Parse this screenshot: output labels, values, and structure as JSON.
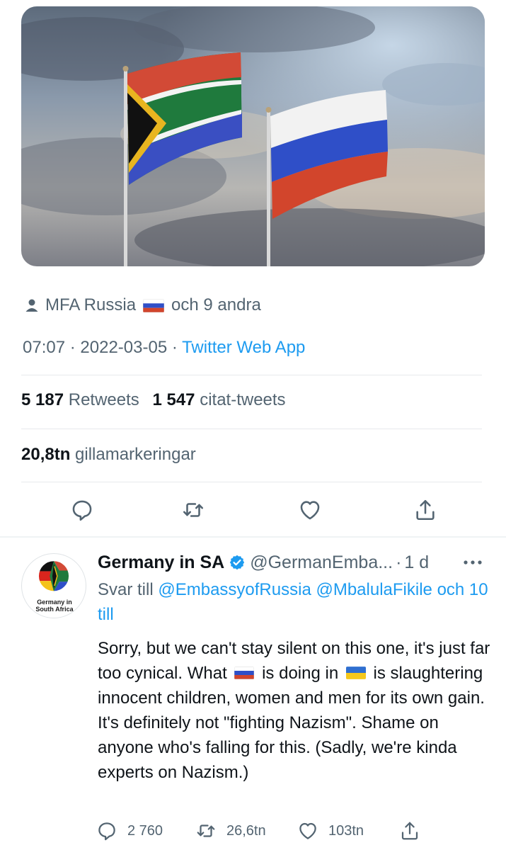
{
  "tweet": {
    "media": {
      "description_icon": "flags-photo",
      "subject": "South Africa and Russia flags against cloudy sky"
    },
    "liked_by": {
      "name": "MFA Russia",
      "suffix": "och 9 andra",
      "flag": "russia"
    },
    "timestamp": {
      "time": "07:07",
      "separator": "·",
      "date": "2022-03-05",
      "source": "Twitter Web App"
    },
    "stats": {
      "retweets_count": "5 187",
      "retweets_label": "Retweets",
      "quotes_count": "1 547",
      "quotes_label": "citat-tweets",
      "likes_count": "20,8tn",
      "likes_label": "gillamarkeringar"
    },
    "actions": [
      "reply-icon",
      "retweet-icon",
      "like-icon",
      "share-icon"
    ]
  },
  "reply": {
    "avatar_text_line1": "Germany in",
    "avatar_text_line2": "South Africa",
    "author_name": "Germany in SA",
    "handle": "@GermanEmba...",
    "separator": "·",
    "time": "1 d",
    "reply_to_prefix": "Svar till",
    "mention1": "@EmbassyofRussia",
    "mention2": "@MbalulaFikile",
    "reply_to_suffix": "och 10 till",
    "body": {
      "part1": "Sorry, but we can't stay silent on this one, it's just far too cynical. What",
      "part2": "is doing in",
      "part3": "is slaughtering innocent children, women and men for its own gain. It's definitely not \"fighting Nazism\". Shame on anyone who's falling for this. (Sadly, we're kinda experts on Nazism.)"
    },
    "counts": {
      "replies": "2 760",
      "retweets": "26,6tn",
      "likes": "103tn"
    }
  },
  "colors": {
    "accent": "#1d9bf0",
    "secondary_text": "#536471",
    "primary_text": "#0f1419"
  }
}
